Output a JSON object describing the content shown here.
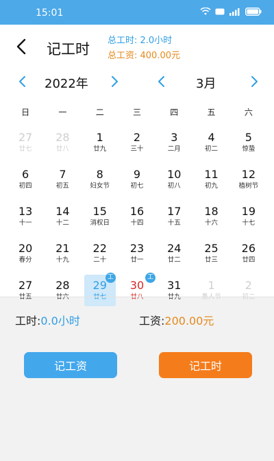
{
  "status_bar": {
    "time": "15:01"
  },
  "header": {
    "title": "记工时",
    "total_hours": "总工时: 2.0小时",
    "total_wage": "总工资: 400.00元"
  },
  "year_selector": {
    "label": "2022年"
  },
  "month_selector": {
    "label": "3月"
  },
  "weekdays": [
    "日",
    "一",
    "二",
    "三",
    "四",
    "五",
    "六"
  ],
  "days": [
    {
      "num": "27",
      "lunar": "廿七",
      "faded": true
    },
    {
      "num": "28",
      "lunar": "廿八",
      "faded": true
    },
    {
      "num": "1",
      "lunar": "廿九"
    },
    {
      "num": "2",
      "lunar": "三十"
    },
    {
      "num": "3",
      "lunar": "二月"
    },
    {
      "num": "4",
      "lunar": "初二"
    },
    {
      "num": "5",
      "lunar": "惊蛰"
    },
    {
      "num": "6",
      "lunar": "初四"
    },
    {
      "num": "7",
      "lunar": "初五"
    },
    {
      "num": "8",
      "lunar": "妇女节"
    },
    {
      "num": "9",
      "lunar": "初七"
    },
    {
      "num": "10",
      "lunar": "初八"
    },
    {
      "num": "11",
      "lunar": "初九"
    },
    {
      "num": "12",
      "lunar": "植树节"
    },
    {
      "num": "13",
      "lunar": "十一"
    },
    {
      "num": "14",
      "lunar": "十二"
    },
    {
      "num": "15",
      "lunar": "消权日"
    },
    {
      "num": "16",
      "lunar": "十四"
    },
    {
      "num": "17",
      "lunar": "十五"
    },
    {
      "num": "18",
      "lunar": "十六"
    },
    {
      "num": "19",
      "lunar": "十七"
    },
    {
      "num": "20",
      "lunar": "春分"
    },
    {
      "num": "21",
      "lunar": "十九"
    },
    {
      "num": "22",
      "lunar": "二十"
    },
    {
      "num": "23",
      "lunar": "廿一"
    },
    {
      "num": "24",
      "lunar": "廿二"
    },
    {
      "num": "25",
      "lunar": "廿三"
    },
    {
      "num": "26",
      "lunar": "廿四"
    },
    {
      "num": "27",
      "lunar": "廿五"
    },
    {
      "num": "28",
      "lunar": "廿六"
    },
    {
      "num": "29",
      "lunar": "廿七",
      "selected": true,
      "badge": "工"
    },
    {
      "num": "30",
      "lunar": "廿八",
      "today": true,
      "badge": "工"
    },
    {
      "num": "31",
      "lunar": "廿九"
    },
    {
      "num": "1",
      "lunar": "愚人节",
      "faded": true
    },
    {
      "num": "2",
      "lunar": "初二",
      "faded": true
    }
  ],
  "stats": {
    "hours_label": "工时:",
    "hours_value": "0.0小时",
    "wage_label": "工资:",
    "wage_value": "200.00元"
  },
  "buttons": {
    "record_wage": "记工资",
    "record_hours": "记工时"
  },
  "colors": {
    "status_bar": "#4da9e8",
    "accent_blue": "#2f9ee3",
    "accent_orange": "#e38a1e",
    "today_red": "#d42828",
    "button_blue": "#43a7ec",
    "button_orange": "#f57c1b"
  }
}
